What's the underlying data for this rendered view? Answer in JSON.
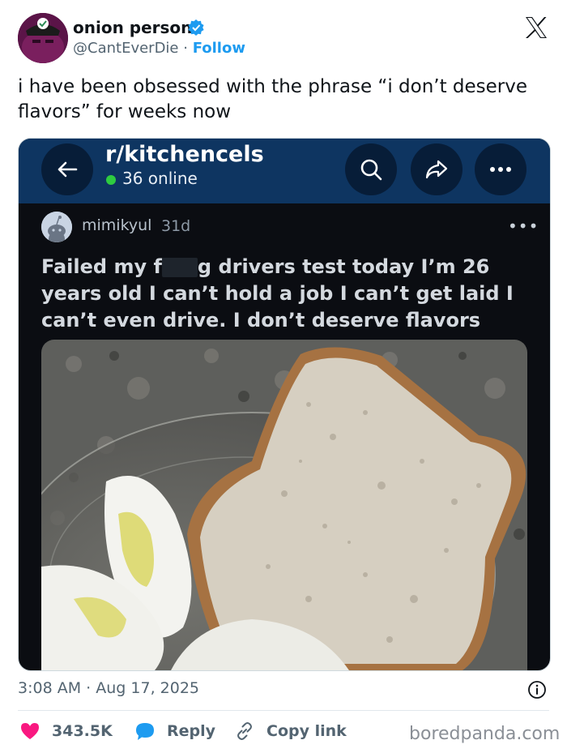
{
  "author": {
    "name": "onion person",
    "handle": "@CantEverDie",
    "separator": "·",
    "follow_label": "Follow"
  },
  "icons": {
    "verified": "verified-badge-icon",
    "x_logo": "x-logo-icon",
    "info": "info-icon",
    "like": "heart-icon",
    "reply": "speech-bubble-icon",
    "copy_link": "link-icon"
  },
  "tweet": {
    "text": "i have been obsessed with the phrase “i don’t deserve flavors” for weeks now"
  },
  "embedded_post": {
    "subreddit": "r/kitchencels",
    "online": "36 online",
    "username": "mimikyul",
    "age": "31d",
    "title_part1": "Failed my f",
    "title_part2": "g drivers test today I’m 26 years old I can’t hold a job I can’t get laid I can’t even drive. I don’t deserve flavors",
    "more": "•••"
  },
  "meta": {
    "time": "3:08 AM",
    "separator": "·",
    "date": "Aug 17, 2025"
  },
  "actions": {
    "likes": "343.5K",
    "reply": "Reply",
    "copy_link": "Copy link"
  },
  "watermark": "boredpanda.com",
  "colors": {
    "like": "#f91880",
    "link": "#1d9bf0",
    "reddit_bar": "#0e3561",
    "online_dot": "#2ecc40"
  }
}
